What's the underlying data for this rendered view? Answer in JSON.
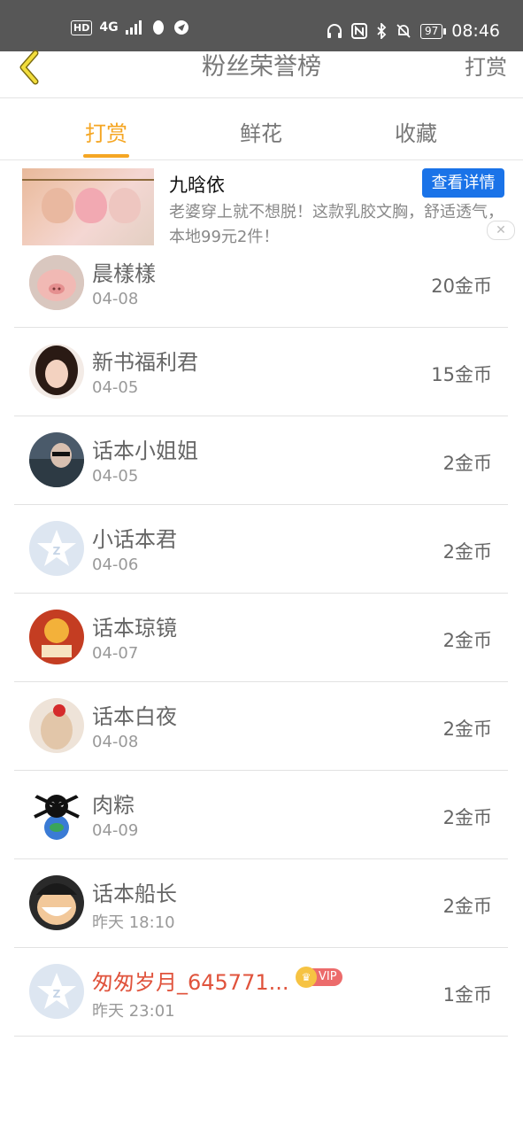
{
  "status_bar": {
    "network": "HD",
    "signal": "4G",
    "battery": "97",
    "time": "08:46"
  },
  "nav": {
    "title": "粉丝荣誉榜",
    "action": "打赏"
  },
  "tabs": [
    {
      "label": "打赏",
      "active": true
    },
    {
      "label": "鲜花",
      "active": false
    },
    {
      "label": "收藏",
      "active": false
    }
  ],
  "ad": {
    "brand": "九晗依",
    "button": "查看详情",
    "description": "老婆穿上就不想脱！这款乳胶文胸，舒适透气，本地99元2件！",
    "close": "✕"
  },
  "fans": [
    {
      "name": "晨樣樣",
      "date": "04-08",
      "coins": "20金币"
    },
    {
      "name": "新书福利君",
      "date": "04-05",
      "coins": "15金币"
    },
    {
      "name": "话本小姐姐",
      "date": "04-05",
      "coins": "2金币"
    },
    {
      "name": "小话本君",
      "date": "04-06",
      "coins": "2金币"
    },
    {
      "name": "话本琼镜",
      "date": "04-07",
      "coins": "2金币"
    },
    {
      "name": "话本白夜",
      "date": "04-08",
      "coins": "2金币"
    },
    {
      "name": "肉粽",
      "date": "04-09",
      "coins": "2金币"
    },
    {
      "name": "话本船长",
      "date": "昨天 18:10",
      "coins": "2金币"
    },
    {
      "name": "匆匆岁月_645771...",
      "date": "昨天 23:01",
      "coins": "1金币",
      "vip": "VIP"
    }
  ],
  "colors": {
    "accent": "#f5a623",
    "ad_button": "#1a73e8",
    "vip_name": "#e0533c"
  }
}
